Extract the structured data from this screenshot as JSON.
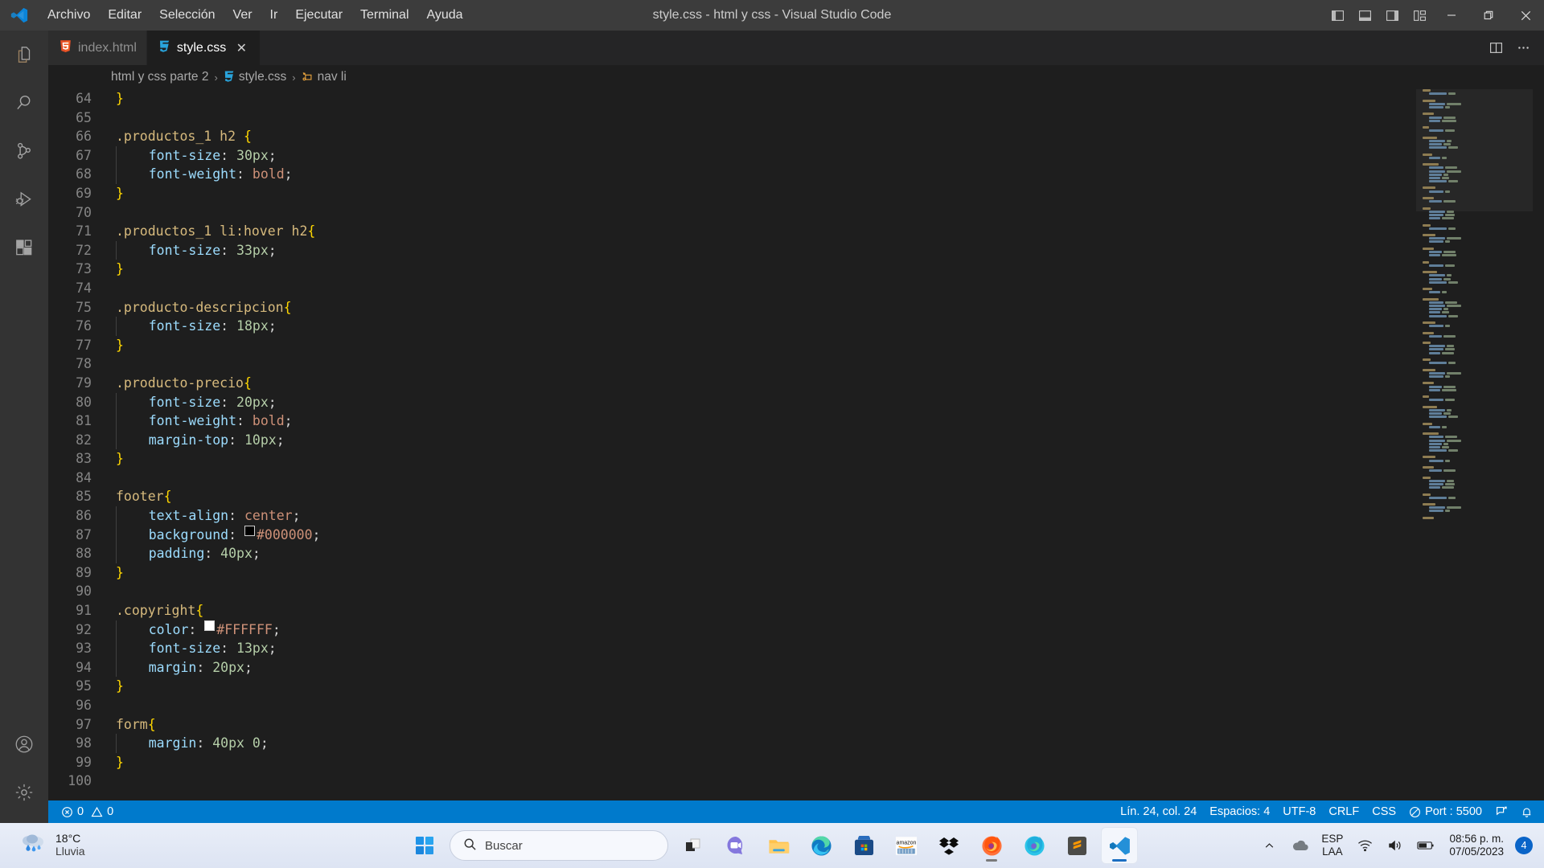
{
  "window": {
    "title": "style.css - html y css - Visual Studio Code",
    "menus": [
      "Archivo",
      "Editar",
      "Selección",
      "Ver",
      "Ir",
      "Ejecutar",
      "Terminal",
      "Ayuda"
    ],
    "layout_buttons": [
      {
        "name": "toggle-primary-sidebar",
        "label": "Alternar barra lateral principal"
      },
      {
        "name": "toggle-panel",
        "label": "Alternar panel"
      },
      {
        "name": "toggle-secondary-sidebar",
        "label": "Alternar barra lateral secundaria"
      },
      {
        "name": "customize-layout",
        "label": "Personalizar diseño"
      }
    ],
    "controls": [
      {
        "name": "minimize",
        "glyph": "—"
      },
      {
        "name": "restore",
        "glyph": "❐"
      },
      {
        "name": "close",
        "glyph": "✕"
      }
    ]
  },
  "activitybar": {
    "items": [
      {
        "name": "explorer",
        "label": "Explorador"
      },
      {
        "name": "search",
        "label": "Buscar"
      },
      {
        "name": "source-control",
        "label": "Control de código fuente"
      },
      {
        "name": "run-debug",
        "label": "Ejecutar y depurar"
      },
      {
        "name": "extensions",
        "label": "Extensiones"
      }
    ],
    "bottom": [
      {
        "name": "account",
        "label": "Cuentas"
      },
      {
        "name": "settings",
        "label": "Administrar"
      }
    ]
  },
  "tabs": [
    {
      "label": "index.html",
      "icon": "html5-icon",
      "active": false,
      "closeable": false
    },
    {
      "label": "style.css",
      "icon": "css3-icon",
      "active": true,
      "closeable": true,
      "close_glyph": "✕"
    }
  ],
  "tab_actions": [
    {
      "name": "split-editor-right",
      "label": "Dividir el editor a la derecha"
    },
    {
      "name": "more-actions",
      "label": "Más acciones...",
      "glyph": "···"
    }
  ],
  "breadcrumbs": [
    {
      "label": "html y css parte 2",
      "icon": null
    },
    {
      "label": "style.css",
      "icon": "css3-icon"
    },
    {
      "label": "nav li",
      "icon": "css-selector-icon"
    }
  ],
  "breadcrumb_separator": "›",
  "editor": {
    "first_line": 64,
    "tab_size_hint": 4,
    "lines": [
      {
        "n": 64,
        "tokens": [
          {
            "t": "}",
            "c": "brace"
          }
        ],
        "indent": 0
      },
      {
        "n": 65,
        "tokens": [],
        "indent": 0
      },
      {
        "n": 66,
        "tokens": [
          {
            "t": ".productos_1 h2 ",
            "c": "sel"
          },
          {
            "t": "{",
            "c": "brace"
          }
        ],
        "indent": 0
      },
      {
        "n": 67,
        "tokens": [
          {
            "t": "font-size",
            "c": "prop"
          },
          {
            "t": ": ",
            "c": "punct"
          },
          {
            "t": "30px",
            "c": "num"
          },
          {
            "t": ";",
            "c": "punct"
          }
        ],
        "indent": 1
      },
      {
        "n": 68,
        "tokens": [
          {
            "t": "font-weight",
            "c": "prop"
          },
          {
            "t": ": ",
            "c": "punct"
          },
          {
            "t": "bold",
            "c": "val"
          },
          {
            "t": ";",
            "c": "punct"
          }
        ],
        "indent": 1
      },
      {
        "n": 69,
        "tokens": [
          {
            "t": "}",
            "c": "brace"
          }
        ],
        "indent": 0
      },
      {
        "n": 70,
        "tokens": [],
        "indent": 0
      },
      {
        "n": 71,
        "tokens": [
          {
            "t": ".productos_1 li:hover h2",
            "c": "sel"
          },
          {
            "t": "{",
            "c": "brace"
          }
        ],
        "indent": 0
      },
      {
        "n": 72,
        "tokens": [
          {
            "t": "font-size",
            "c": "prop"
          },
          {
            "t": ": ",
            "c": "punct"
          },
          {
            "t": "33px",
            "c": "num"
          },
          {
            "t": ";",
            "c": "punct"
          }
        ],
        "indent": 1
      },
      {
        "n": 73,
        "tokens": [
          {
            "t": "}",
            "c": "brace"
          }
        ],
        "indent": 0
      },
      {
        "n": 74,
        "tokens": [],
        "indent": 0
      },
      {
        "n": 75,
        "tokens": [
          {
            "t": ".producto-descripcion",
            "c": "sel"
          },
          {
            "t": "{",
            "c": "brace"
          }
        ],
        "indent": 0
      },
      {
        "n": 76,
        "tokens": [
          {
            "t": "font-size",
            "c": "prop"
          },
          {
            "t": ": ",
            "c": "punct"
          },
          {
            "t": "18px",
            "c": "num"
          },
          {
            "t": ";",
            "c": "punct"
          }
        ],
        "indent": 1
      },
      {
        "n": 77,
        "tokens": [
          {
            "t": "}",
            "c": "brace"
          }
        ],
        "indent": 0
      },
      {
        "n": 78,
        "tokens": [],
        "indent": 0
      },
      {
        "n": 79,
        "tokens": [
          {
            "t": ".producto-precio",
            "c": "sel"
          },
          {
            "t": "{",
            "c": "brace"
          }
        ],
        "indent": 0
      },
      {
        "n": 80,
        "tokens": [
          {
            "t": "font-size",
            "c": "prop"
          },
          {
            "t": ": ",
            "c": "punct"
          },
          {
            "t": "20px",
            "c": "num"
          },
          {
            "t": ";",
            "c": "punct"
          }
        ],
        "indent": 1
      },
      {
        "n": 81,
        "tokens": [
          {
            "t": "font-weight",
            "c": "prop"
          },
          {
            "t": ": ",
            "c": "punct"
          },
          {
            "t": "bold",
            "c": "val"
          },
          {
            "t": ";",
            "c": "punct"
          }
        ],
        "indent": 1
      },
      {
        "n": 82,
        "tokens": [
          {
            "t": "margin-top",
            "c": "prop"
          },
          {
            "t": ": ",
            "c": "punct"
          },
          {
            "t": "10px",
            "c": "num"
          },
          {
            "t": ";",
            "c": "punct"
          }
        ],
        "indent": 1
      },
      {
        "n": 83,
        "tokens": [
          {
            "t": "}",
            "c": "brace"
          }
        ],
        "indent": 0
      },
      {
        "n": 84,
        "tokens": [],
        "indent": 0
      },
      {
        "n": 85,
        "tokens": [
          {
            "t": "footer",
            "c": "tag"
          },
          {
            "t": "{",
            "c": "brace"
          }
        ],
        "indent": 0
      },
      {
        "n": 86,
        "tokens": [
          {
            "t": "text-align",
            "c": "prop"
          },
          {
            "t": ": ",
            "c": "punct"
          },
          {
            "t": "center",
            "c": "val"
          },
          {
            "t": ";",
            "c": "punct"
          }
        ],
        "indent": 1
      },
      {
        "n": 87,
        "tokens": [
          {
            "t": "background",
            "c": "prop"
          },
          {
            "t": ": ",
            "c": "punct"
          },
          {
            "t": "#000000",
            "c": "val",
            "swatch": "#000000"
          },
          {
            "t": ";",
            "c": "punct"
          }
        ],
        "indent": 1
      },
      {
        "n": 88,
        "tokens": [
          {
            "t": "padding",
            "c": "prop"
          },
          {
            "t": ": ",
            "c": "punct"
          },
          {
            "t": "40px",
            "c": "num"
          },
          {
            "t": ";",
            "c": "punct"
          }
        ],
        "indent": 1
      },
      {
        "n": 89,
        "tokens": [
          {
            "t": "}",
            "c": "brace"
          }
        ],
        "indent": 0
      },
      {
        "n": 90,
        "tokens": [],
        "indent": 0
      },
      {
        "n": 91,
        "tokens": [
          {
            "t": ".copyright",
            "c": "sel"
          },
          {
            "t": "{",
            "c": "brace"
          }
        ],
        "indent": 0
      },
      {
        "n": 92,
        "tokens": [
          {
            "t": "color",
            "c": "prop"
          },
          {
            "t": ": ",
            "c": "punct"
          },
          {
            "t": "#FFFFFF",
            "c": "val",
            "swatch": "#FFFFFF"
          },
          {
            "t": ";",
            "c": "punct"
          }
        ],
        "indent": 1
      },
      {
        "n": 93,
        "tokens": [
          {
            "t": "font-size",
            "c": "prop"
          },
          {
            "t": ": ",
            "c": "punct"
          },
          {
            "t": "13px",
            "c": "num"
          },
          {
            "t": ";",
            "c": "punct"
          }
        ],
        "indent": 1
      },
      {
        "n": 94,
        "tokens": [
          {
            "t": "margin",
            "c": "prop"
          },
          {
            "t": ": ",
            "c": "punct"
          },
          {
            "t": "20px",
            "c": "num"
          },
          {
            "t": ";",
            "c": "punct"
          }
        ],
        "indent": 1
      },
      {
        "n": 95,
        "tokens": [
          {
            "t": "}",
            "c": "brace"
          }
        ],
        "indent": 0
      },
      {
        "n": 96,
        "tokens": [],
        "indent": 0
      },
      {
        "n": 97,
        "tokens": [
          {
            "t": "form",
            "c": "tag"
          },
          {
            "t": "{",
            "c": "brace"
          }
        ],
        "indent": 0
      },
      {
        "n": 98,
        "tokens": [
          {
            "t": "margin",
            "c": "prop"
          },
          {
            "t": ": ",
            "c": "punct"
          },
          {
            "t": "40px 0",
            "c": "num"
          },
          {
            "t": ";",
            "c": "punct"
          }
        ],
        "indent": 1
      },
      {
        "n": 99,
        "tokens": [
          {
            "t": "}",
            "c": "brace"
          }
        ],
        "indent": 0
      },
      {
        "n": 100,
        "tokens": [],
        "indent": 0
      }
    ]
  },
  "statusbar": {
    "left": [
      {
        "name": "problems",
        "icon": "error-icon",
        "errors": "0",
        "warnings": "0"
      }
    ],
    "right": [
      {
        "name": "editor-position",
        "label": "Lín. 24, col. 24"
      },
      {
        "name": "indentation",
        "label": "Espacios: 4"
      },
      {
        "name": "encoding",
        "label": "UTF-8"
      },
      {
        "name": "eol",
        "label": "CRLF"
      },
      {
        "name": "language-mode",
        "label": "CSS"
      },
      {
        "name": "live-server-port",
        "label": "Port : 5500",
        "icon": "broadcast-icon"
      },
      {
        "name": "remote-feedback",
        "icon": "feedback-icon"
      },
      {
        "name": "notifications",
        "icon": "bell-icon"
      }
    ]
  },
  "taskbar": {
    "weather": {
      "temperature": "18°C",
      "condition": "Lluvia",
      "icon": "rain-cloud-icon"
    },
    "start": {
      "name": "start-button",
      "label": "Inicio"
    },
    "search": {
      "placeholder": "Buscar",
      "icon": "search-icon"
    },
    "apps": [
      {
        "name": "task-view",
        "label": "Vista de tareas"
      },
      {
        "name": "microsoft-teams",
        "label": "Microsoft Teams"
      },
      {
        "name": "file-explorer",
        "label": "Explorador de archivos"
      },
      {
        "name": "microsoft-edge",
        "label": "Microsoft Edge"
      },
      {
        "name": "microsoft-store",
        "label": "Microsoft Store"
      },
      {
        "name": "amazon",
        "label": "Amazon"
      },
      {
        "name": "dropbox",
        "label": "Dropbox"
      },
      {
        "name": "firefox",
        "label": "Mozilla Firefox",
        "running": true
      },
      {
        "name": "firefox-developer",
        "label": "Firefox Developer Edition"
      },
      {
        "name": "sublime-text",
        "label": "Sublime Text"
      },
      {
        "name": "visual-studio-code",
        "label": "Visual Studio Code",
        "running": true,
        "active": true
      }
    ],
    "tray": {
      "chevron": {
        "name": "show-hidden-icons",
        "glyph": "⌃"
      },
      "onedrive": {
        "name": "onedrive-icon"
      },
      "language": {
        "line1": "ESP",
        "line2": "LAA"
      },
      "wifi": {
        "name": "wifi-icon"
      },
      "volume": {
        "name": "volume-icon"
      },
      "battery": {
        "name": "battery-icon"
      },
      "clock": {
        "time": "08:56 p. m.",
        "date": "07/05/2023"
      },
      "notifications": {
        "count": "4"
      }
    }
  },
  "colors": {
    "titlebar": "#3c3c3c",
    "activitybar": "#333333",
    "editor": "#1e1e1e",
    "tabbar": "#252526",
    "statusbar": "#007acc",
    "accent": "#007acc",
    "selector": "#d7ba7d",
    "property": "#9cdcfe",
    "value": "#ce9178",
    "number": "#b5cea8",
    "brace": "#ffd700"
  }
}
